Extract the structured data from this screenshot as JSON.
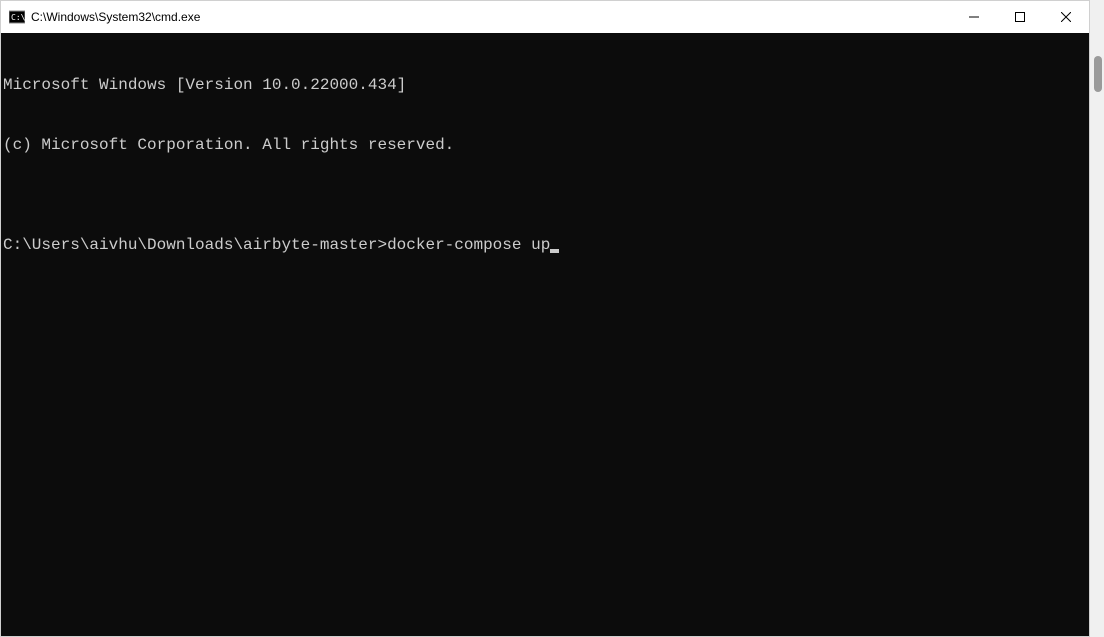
{
  "window": {
    "title": "C:\\Windows\\System32\\cmd.exe"
  },
  "terminal": {
    "line1": "Microsoft Windows [Version 10.0.22000.434]",
    "line2": "(c) Microsoft Corporation. All rights reserved.",
    "blank": "",
    "prompt": "C:\\Users\\aivhu\\Downloads\\airbyte-master>",
    "command": "docker-compose up"
  }
}
